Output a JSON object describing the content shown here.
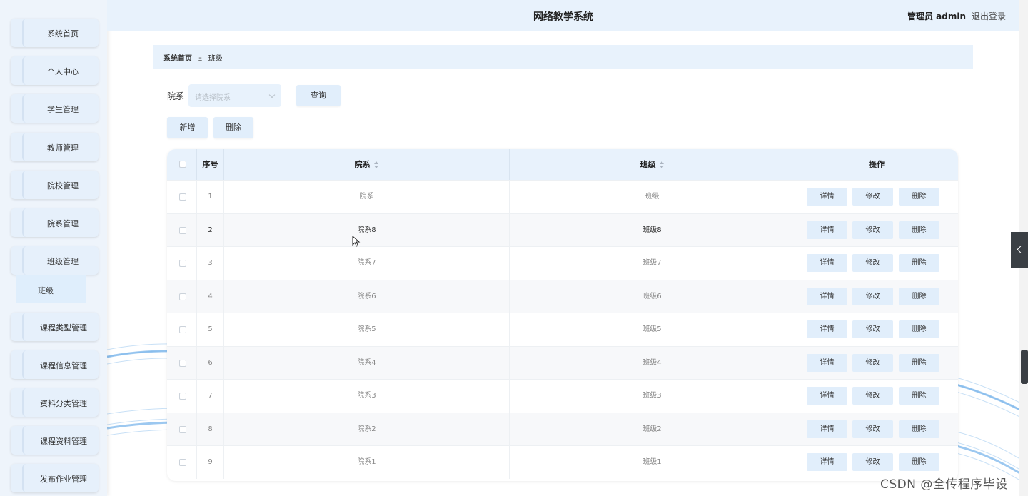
{
  "app": {
    "title": "网络教学系统",
    "user_label": "管理员 admin",
    "logout_label": "退出登录"
  },
  "sidebar": {
    "items": [
      {
        "label": "系统首页"
      },
      {
        "label": "个人中心"
      },
      {
        "label": "学生管理"
      },
      {
        "label": "教师管理"
      },
      {
        "label": "院校管理"
      },
      {
        "label": "院系管理"
      },
      {
        "label": "班级管理"
      },
      {
        "label": "课程类型管理"
      },
      {
        "label": "课程信息管理"
      },
      {
        "label": "资料分类管理"
      },
      {
        "label": "课程资料管理"
      },
      {
        "label": "发布作业管理"
      }
    ],
    "submenu": {
      "label": "班级"
    }
  },
  "breadcrumb": {
    "home": "系统首页",
    "separator": "Ξ",
    "current": "班级"
  },
  "search": {
    "label": "院系",
    "placeholder": "请选择院系",
    "query_button": "查询"
  },
  "toolbar": {
    "add_button": "新增",
    "delete_button": "删除"
  },
  "table": {
    "headers": {
      "index": "序号",
      "department": "院系",
      "class": "班级",
      "actions": "操作"
    },
    "rows": [
      {
        "index": "1",
        "department": "院系",
        "class": "班级"
      },
      {
        "index": "2",
        "department": "院系8",
        "class": "班级8"
      },
      {
        "index": "3",
        "department": "院系7",
        "class": "班级7"
      },
      {
        "index": "4",
        "department": "院系6",
        "class": "班级6"
      },
      {
        "index": "5",
        "department": "院系5",
        "class": "班级5"
      },
      {
        "index": "6",
        "department": "院系4",
        "class": "班级4"
      },
      {
        "index": "7",
        "department": "院系3",
        "class": "班级3"
      },
      {
        "index": "8",
        "department": "院系2",
        "class": "班级2"
      },
      {
        "index": "9",
        "department": "院系1",
        "class": "班级1"
      }
    ],
    "action_labels": {
      "detail": "详情",
      "edit": "修改",
      "delete": "删除"
    },
    "highlighted_row": 2
  },
  "watermark": "CSDN @全传程序毕设",
  "colors": {
    "accent": "#e1eefb",
    "header_bg": "#e8f2fc",
    "sidebar_bg": "#eef4fb"
  }
}
